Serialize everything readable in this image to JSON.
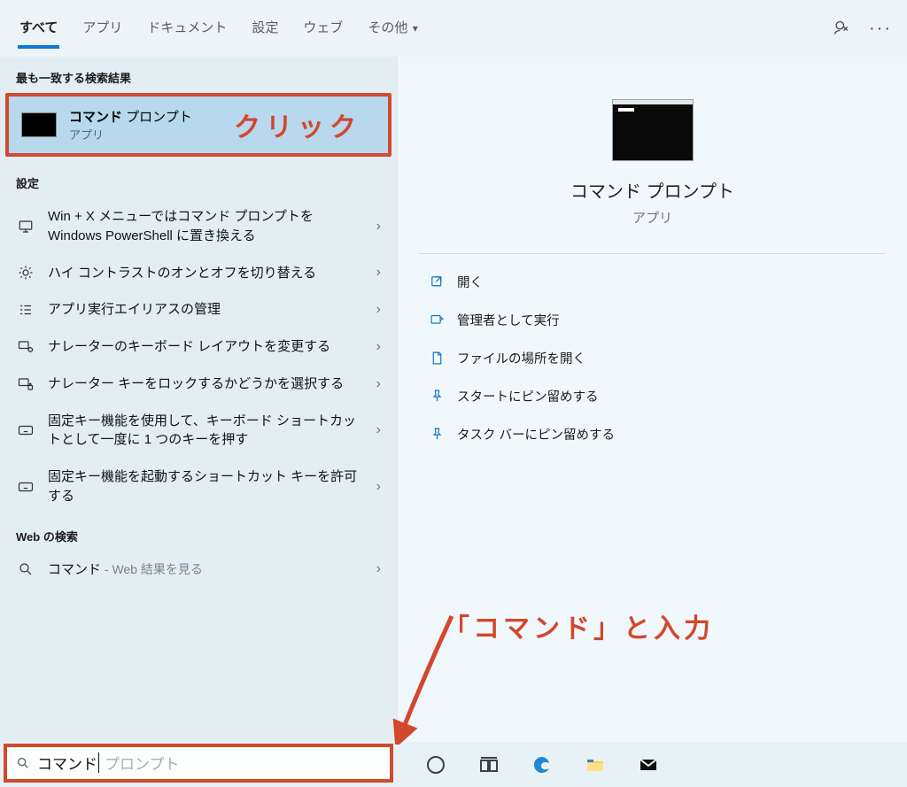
{
  "tabs": {
    "all": "すべて",
    "apps": "アプリ",
    "docs": "ドキュメント",
    "settings": "設定",
    "web": "ウェブ",
    "more": "その他"
  },
  "sections": {
    "best": "最も一致する検索結果",
    "settings": "設定",
    "web": "Web の検索"
  },
  "best_match": {
    "title_bold": "コマンド",
    "title_rest": " プロンプト",
    "subtitle": "アプリ"
  },
  "settings_rows": [
    "Win + X メニューではコマンド プロンプトを Windows PowerShell に置き換える",
    "ハイ コントラストのオンとオフを切り替える",
    "アプリ実行エイリアスの管理",
    "ナレーターのキーボード レイアウトを変更する",
    "ナレーター キーをロックするかどうかを選択する",
    "固定キー機能を使用して、キーボード ショートカットとして一度に 1 つのキーを押す",
    "固定キー機能を起動するショートカット キーを許可する"
  ],
  "web_row": {
    "query": "コマンド",
    "tail": " - Web 結果を見る"
  },
  "preview": {
    "title": "コマンド プロンプト",
    "subtitle": "アプリ",
    "actions": {
      "open": "開く",
      "admin": "管理者として実行",
      "location": "ファイルの場所を開く",
      "pin_start": "スタートにピン留めする",
      "pin_task": "タスク バーにピン留めする"
    }
  },
  "annotations": {
    "click": "クリック",
    "input": "「コマンド」と入力"
  },
  "search": {
    "typed": "コマンド",
    "hint": " プロンプト"
  }
}
